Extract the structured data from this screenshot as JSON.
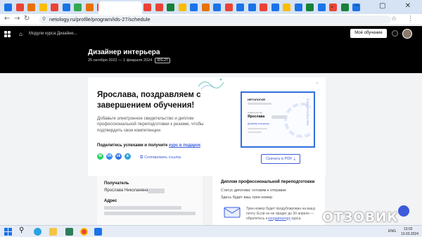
{
  "browser": {
    "url": "netology.ru/profile/program/ids-27/schedule",
    "tab_colors": [
      "#1a73e8",
      "#ea4335",
      "#e8710a",
      "#fbbc04",
      "#ea4335",
      "#1a73e8",
      "#34a853",
      "#e8710a",
      "#ea4335",
      "#1a73e8",
      "#c5221f",
      "#ea4335",
      "#ea4335",
      "#ea4335",
      "#188038",
      "#fbbc04",
      "#1a73e8",
      "#e8710a",
      "#1a73e8",
      "#ea4335",
      "#1a73e8",
      "#1a73e8",
      "#ea4335",
      "#1a73e8",
      "#fbbc04",
      "#1a73e8",
      "#188038",
      "#1a73e8",
      "#ea4335",
      "#188038",
      "#1a73e8"
    ]
  },
  "site": {
    "breadcrumb": "Модули курса Дизайне...",
    "my_learning_button": "Моё обучение",
    "course_title": "Дизайнер интерьера",
    "course_dates": "25 октября 2022 — 1 февраля 2024",
    "course_code": "IDS-27"
  },
  "congrats": {
    "title": "Ярослава, поздравляем с завершением обучения!",
    "text": "Добавьте электронное свидетельство и диплом профессиональной переподготовки к резюме, чтобы подтвердить свои компетенции",
    "share_prefix": "Поделитесь успехами и получите ",
    "share_link": "курс в подарок",
    "social": [
      {
        "name": "whatsapp",
        "label": "W",
        "color": "#25d366"
      },
      {
        "name": "vk",
        "label": "VK",
        "color": "#2787f5"
      },
      {
        "name": "odnoklassniki",
        "label": "ok",
        "color": "#2f6fe0"
      },
      {
        "name": "telegram",
        "label": "➤",
        "color": "#2aa3df"
      }
    ],
    "copy_link": "Скопировать ссылку",
    "pdf_button": "Скачать в PDF"
  },
  "certificate": {
    "logo": "НЕТОЛОГИЯ",
    "label": "Свидетельство",
    "name": "Ярослава",
    "course": "Дизайнер интерьера",
    "vertical_text": "Свидетельство"
  },
  "recipient": {
    "label": "Получатель",
    "name": "Ярослава Николаевна",
    "address_label": "Адрес"
  },
  "diploma": {
    "title": "Диплом профессиональной переподготовки",
    "status": "Статус диплома: готовим к отправке",
    "track": "Здесь будет ваш трек-номер",
    "note_prefix": "Трек-номер будет продублирован на вашу почту. Если он не придет до 30 апреля — обратитесь к ",
    "note_link": "координатору",
    "note_suffix": " курса."
  },
  "watermark": "ОТЗОВИК",
  "taskbar": {
    "language": "ENG",
    "time": "13:02",
    "date": "13.03.2024"
  }
}
